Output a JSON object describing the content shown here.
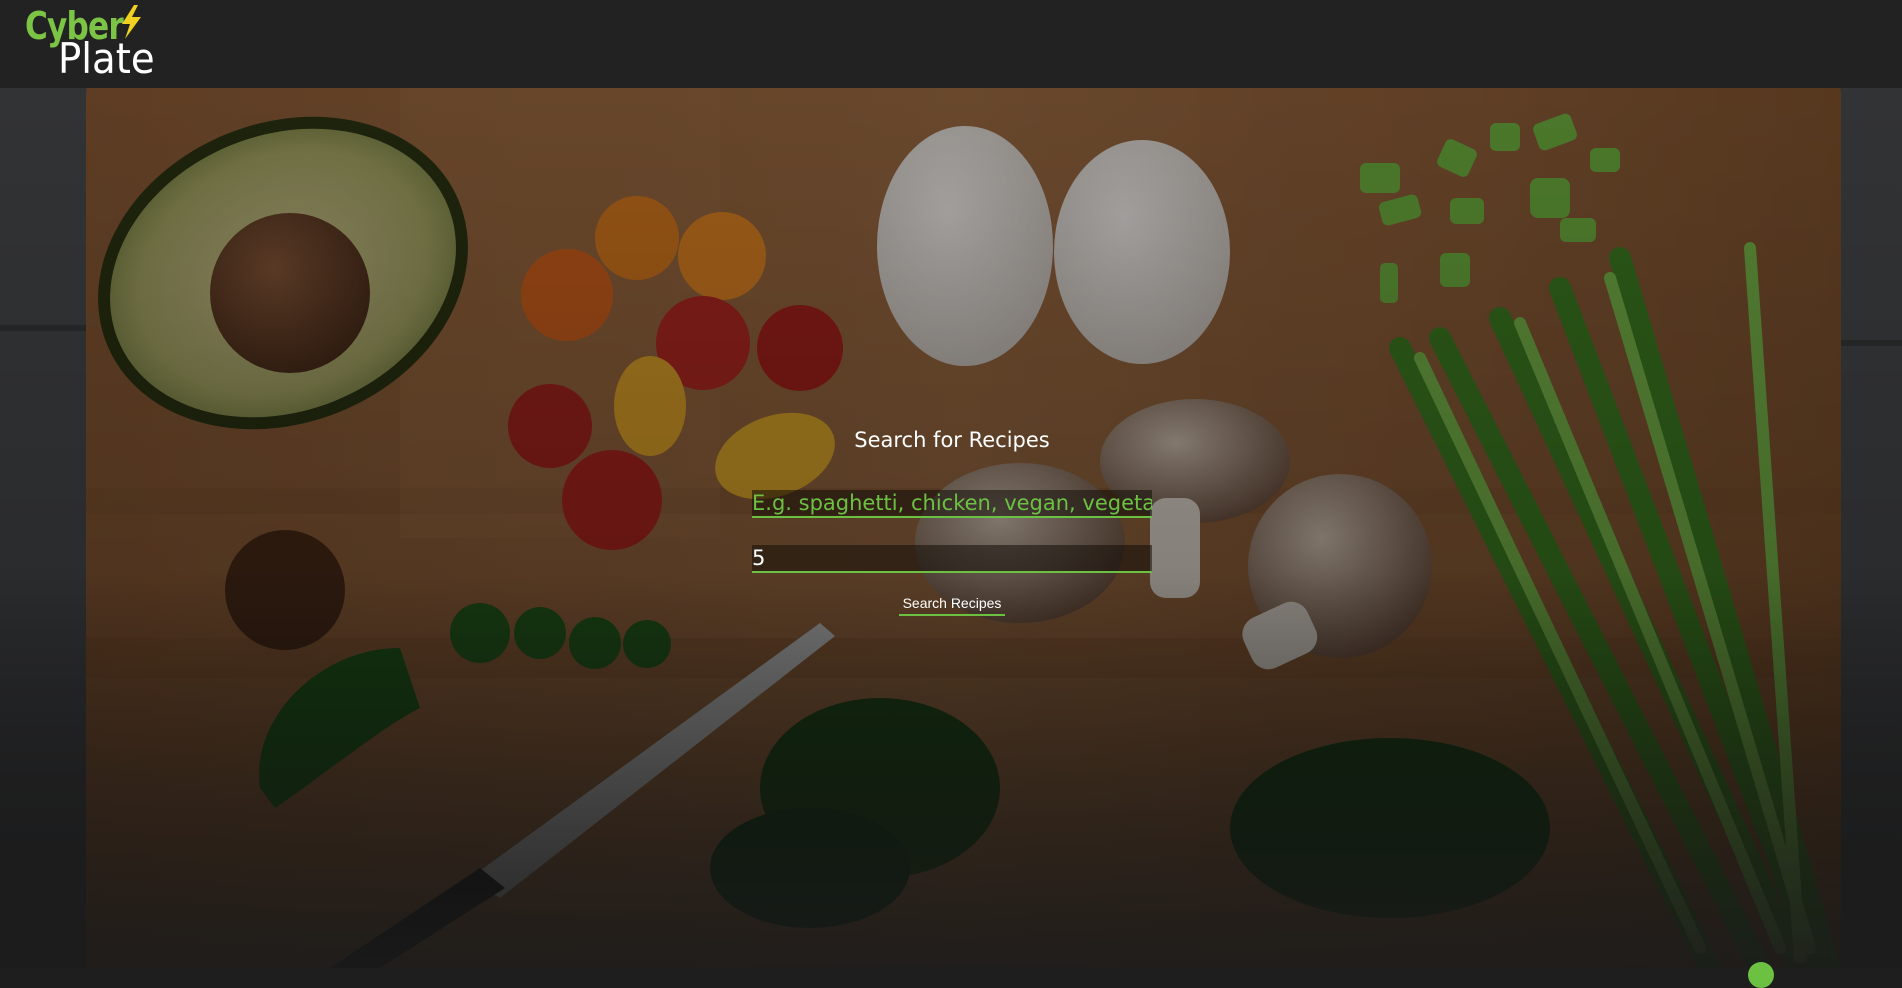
{
  "brand": {
    "name_line1": "Cyber",
    "name_line2": "Plate",
    "bolt_icon": "lightning-bolt-icon",
    "accent_color": "#7cc445"
  },
  "search": {
    "title": "Search for Recipes",
    "query_placeholder": "E.g. spaghetti, chicken, vegan, vegetarian",
    "query_value": "",
    "count_value": "5",
    "button_label": "Search Recipes"
  },
  "colors": {
    "header_bg": "#222222",
    "accent": "#6cc143",
    "text": "#ffffff"
  }
}
